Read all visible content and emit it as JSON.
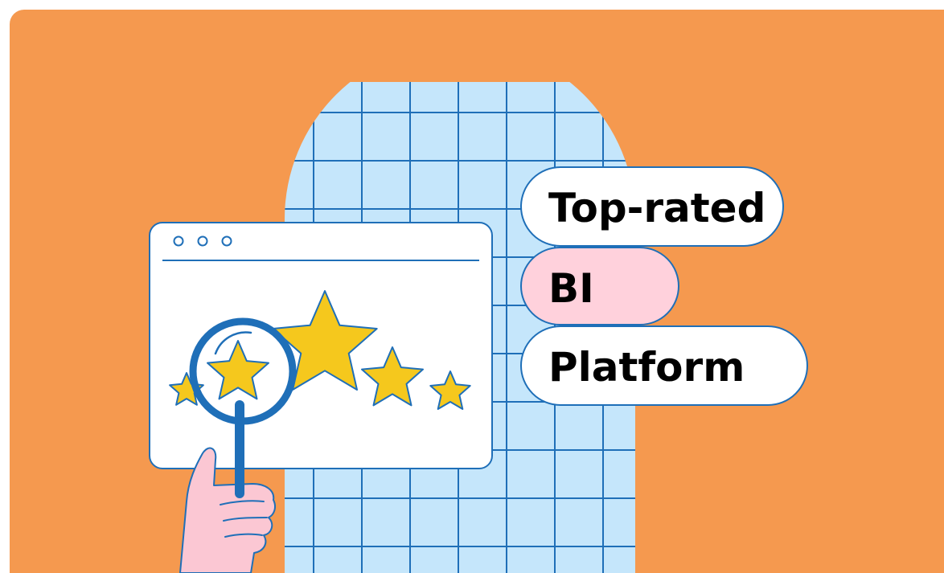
{
  "illustration": {
    "background_color": "#F5994F",
    "grid_color": "#C5E6FB",
    "line_color": "#1F6FB8",
    "star_color": "#F5C81D",
    "pill_highlight_color": "#FFD1DC",
    "hand_color": "#FBC7D3",
    "stars_shown": 5,
    "badges": [
      {
        "label": "Top-rated",
        "highlight": false
      },
      {
        "label": "BI",
        "highlight": true
      },
      {
        "label": "Platform",
        "highlight": false
      }
    ]
  }
}
